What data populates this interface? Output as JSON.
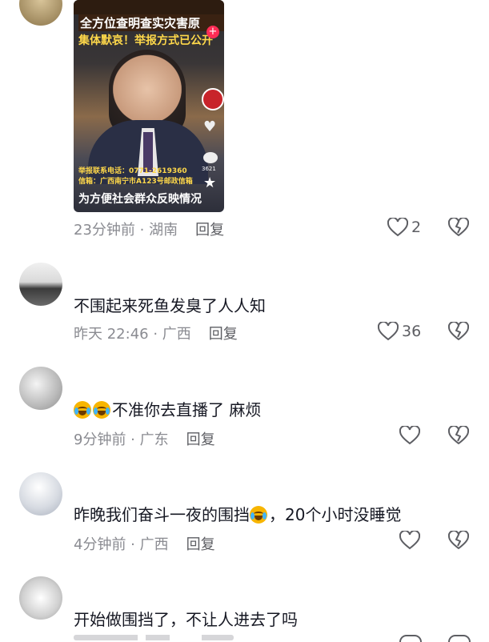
{
  "video": {
    "headline1": "全方位查明查实灾害原",
    "headline2": "集体默哀！举报方式已公开",
    "contact_phone": "举报联系电话：0771-2619360",
    "contact_mail": "信箱：广西南宁市A123号邮政信箱",
    "caption": "为方便社会群众反映情况",
    "side_count": "3621"
  },
  "comments": [
    {
      "time_location": "23分钟前 · 湖南",
      "reply": "回复",
      "likes": "2"
    },
    {
      "username": "",
      "text": "不围起来死鱼发臭了人人知",
      "time_location": "昨天 22:46 · 广西",
      "reply": "回复",
      "likes": "36"
    },
    {
      "username": "",
      "text": "不准你去直播了 麻烦",
      "time_location": "9分钟前 · 广东",
      "reply": "回复",
      "likes": ""
    },
    {
      "username": "",
      "text_a": "昨晚我们奋斗一夜的围挡",
      "text_b": "，20个小时没睡觉",
      "time_location": "4分钟前 · 广西",
      "reply": "回复",
      "likes": ""
    },
    {
      "username": "",
      "text": "开始做围挡了，不让人进去了吗",
      "time_location": "",
      "reply": "",
      "likes": ""
    }
  ]
}
